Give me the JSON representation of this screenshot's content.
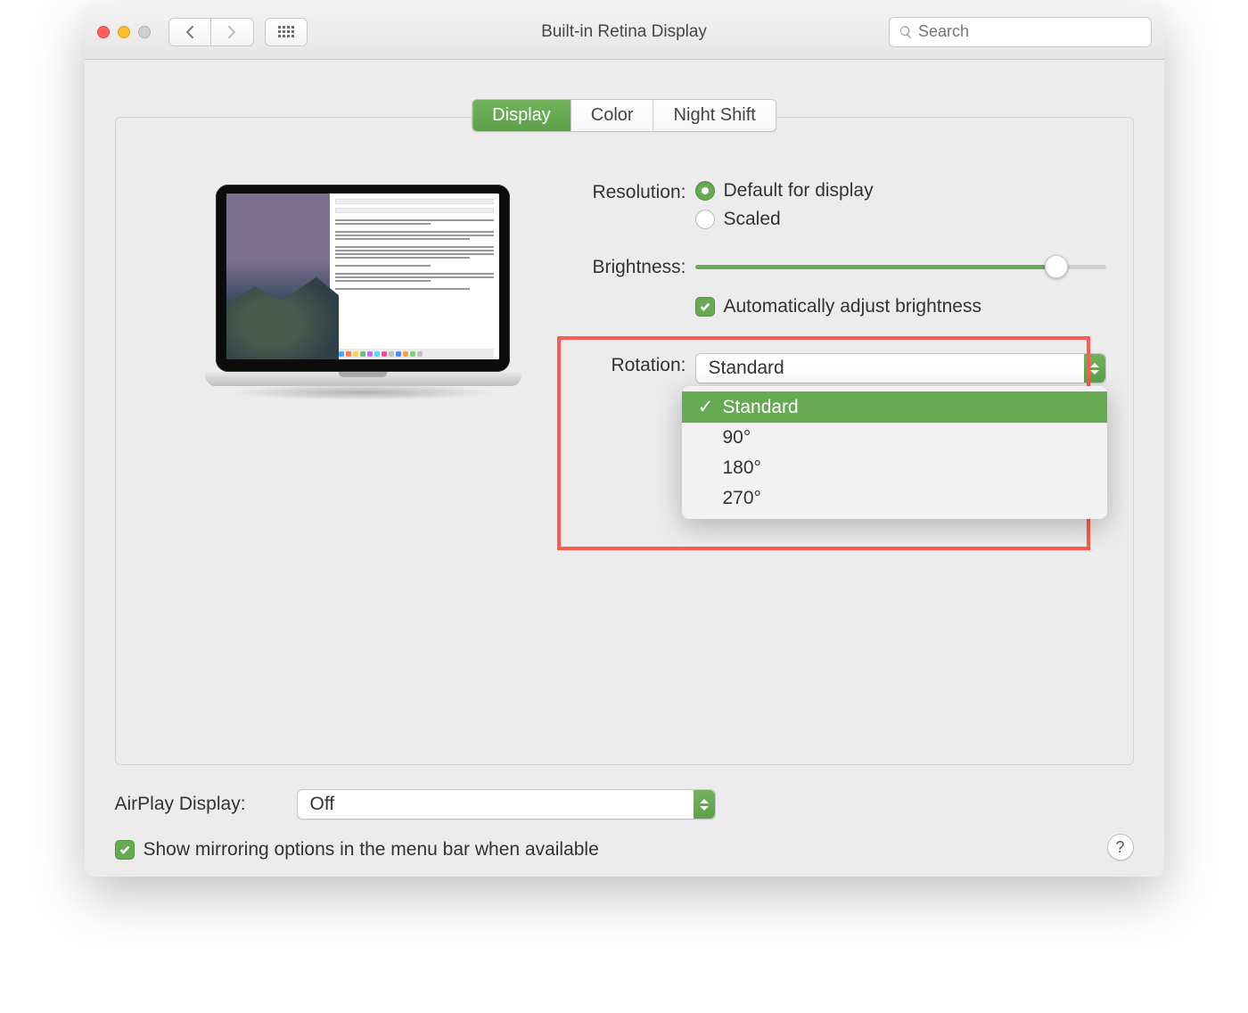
{
  "window": {
    "title": "Built-in Retina Display"
  },
  "toolbar": {
    "search_placeholder": "Search"
  },
  "tabs": {
    "display": "Display",
    "color": "Color",
    "night_shift": "Night Shift"
  },
  "labels": {
    "resolution": "Resolution:",
    "brightness": "Brightness:",
    "rotation": "Rotation:",
    "airplay": "AirPlay Display:"
  },
  "resolution": {
    "default": "Default for display",
    "scaled": "Scaled",
    "selected": "default"
  },
  "brightness": {
    "value_percent": 88,
    "auto_label": "Automatically adjust brightness",
    "auto_checked": true
  },
  "rotation": {
    "selected": "Standard",
    "options": [
      "Standard",
      "90°",
      "180°",
      "270°"
    ]
  },
  "airplay": {
    "selected": "Off"
  },
  "mirroring": {
    "label": "Show mirroring options in the menu bar when available",
    "checked": true
  },
  "help": "?",
  "colors": {
    "accent": "#66aa53",
    "highlight_border": "#ff5a50"
  }
}
